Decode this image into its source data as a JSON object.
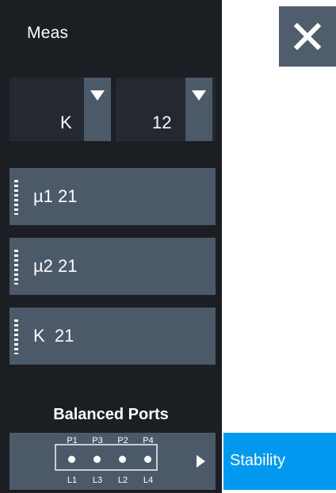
{
  "header": {
    "title": "Meas",
    "close_icon": "close-icon"
  },
  "selectors": [
    {
      "value": "K",
      "icon": "chevron-down-icon"
    },
    {
      "value": "12",
      "icon": "chevron-down-icon"
    }
  ],
  "parameters": [
    {
      "label": "µ1 21"
    },
    {
      "label": "µ2 21"
    },
    {
      "label": "K  21"
    }
  ],
  "balanced_ports": {
    "title": "Balanced Ports",
    "top_labels": [
      "P1",
      "P3",
      "P2",
      "P4"
    ],
    "bottom_labels": [
      "L1",
      "L3",
      "L2",
      "L4"
    ],
    "expand_icon": "triangle-right-icon"
  },
  "tabs": [
    {
      "label": "Stability",
      "active": true
    }
  ],
  "colors": {
    "panel_bg": "#1b1e23",
    "button_bg": "#4c5968",
    "active_tab": "#0099f0"
  }
}
